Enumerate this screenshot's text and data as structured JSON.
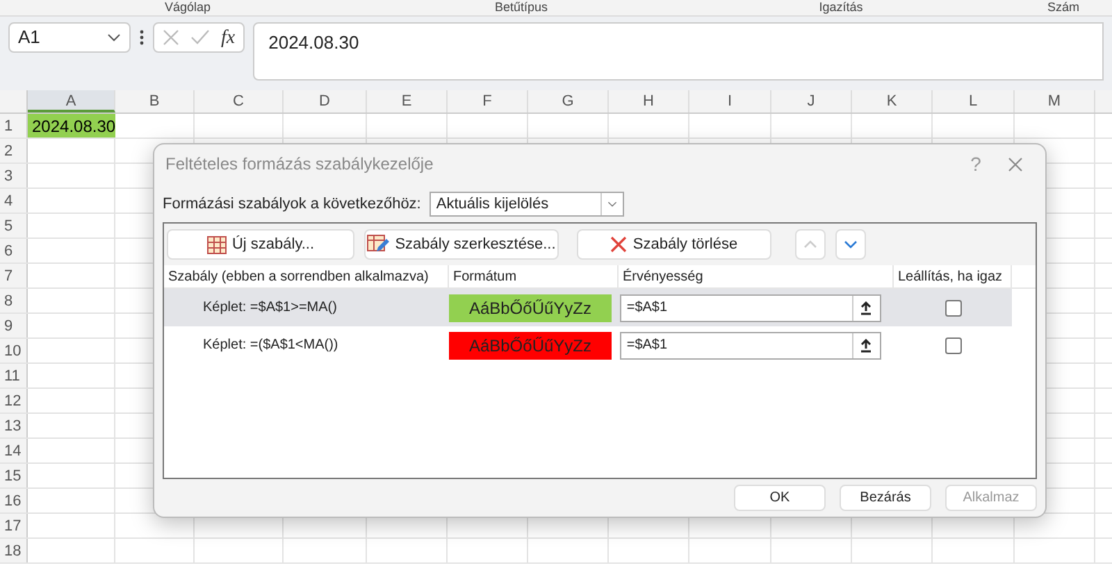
{
  "ribbon_groups": [
    "Vágólap",
    "Betűtípus",
    "Igazítás",
    "Szám"
  ],
  "formula_bar": {
    "name_box": "A1",
    "function_symbol": "fx",
    "value": "2024.08.30"
  },
  "sheet": {
    "columns": [
      "A",
      "B",
      "C",
      "D",
      "E",
      "F",
      "G",
      "H",
      "I",
      "J",
      "K",
      "L",
      "M"
    ],
    "rows": [
      "1",
      "2",
      "3",
      "4",
      "5",
      "6",
      "7",
      "8",
      "9",
      "10",
      "11",
      "12",
      "13",
      "14",
      "15",
      "16",
      "17",
      "18"
    ],
    "cell_a1": {
      "text": "2024.08.30",
      "color": "#92d050"
    }
  },
  "dialog": {
    "title": "Feltételes formázás szabálykezelője",
    "help": "?",
    "scope_label": "Formázási szabályok a következőhöz:",
    "scope_value": "Aktuális kijelölés",
    "toolbar": [
      {
        "kind": "new",
        "label": "Új szabály..."
      },
      {
        "kind": "edit",
        "label": "Szabály szerkesztése..."
      },
      {
        "kind": "delete",
        "label": "Szabály törlése"
      },
      {
        "kind": "up",
        "disabled": true
      },
      {
        "kind": "down",
        "disabled": false
      }
    ],
    "columns": [
      "Szabály (ebben a sorrendben alkalmazva)",
      "Formátum",
      "Érvényesség",
      "Leállítás, ha igaz"
    ],
    "rules": [
      {
        "rule": "Képlet: =$A$1>=MA()",
        "preview": "AáBbŐőŰűYyZz",
        "color": "#92d050",
        "applies_to": "=$A$1",
        "stop": false,
        "selected": true
      },
      {
        "rule": "Képlet: =($A$1<MA())",
        "preview": "AáBbŐőŰűYyZz",
        "color": "#ff0000",
        "applies_to": "=$A$1",
        "stop": false,
        "selected": false
      }
    ],
    "buttons": [
      {
        "label": "OK",
        "disabled": false
      },
      {
        "label": "Bezárás",
        "disabled": false
      },
      {
        "label": "Alkalmaz",
        "disabled": true
      }
    ]
  }
}
